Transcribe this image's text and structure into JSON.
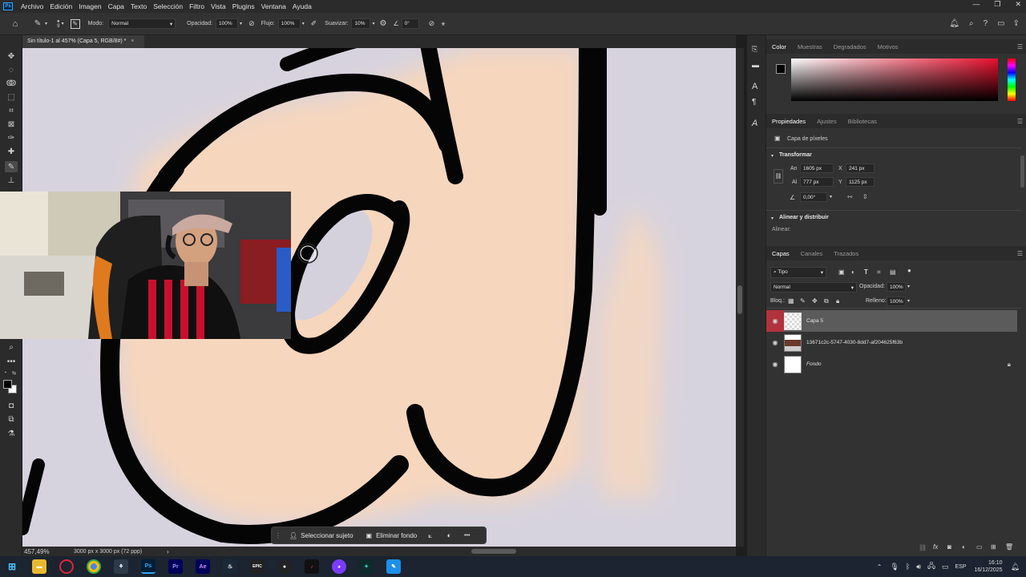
{
  "menubar": {
    "logo": "Ps",
    "items": [
      "Archivo",
      "Edición",
      "Imagen",
      "Capa",
      "Texto",
      "Selección",
      "Filtro",
      "Vista",
      "Plugins",
      "Ventana",
      "Ayuda"
    ]
  },
  "options": {
    "brush_size": "9",
    "mode_label": "Modo:",
    "mode_value": "Normal",
    "opacity_label": "Opacidad:",
    "opacity_value": "100%",
    "flow_label": "Flujo:",
    "flow_value": "100%",
    "smooth_label": "Suavizar:",
    "smooth_value": "10%",
    "angle_value": "0°"
  },
  "document": {
    "tab_title": "Sin título-1 al 457% (Capa 5, RGB/8#) *",
    "close": "×",
    "zoom": "457,49%",
    "size_info": "3000 px x 3000 px (72 ppp)",
    "status_arrow": "›"
  },
  "contextbar": {
    "select_subject": "Seleccionar sujeto",
    "remove_bg": "Eliminar fondo",
    "more": "•••"
  },
  "color_panel": {
    "tabs": [
      "Color",
      "Muestras",
      "Degradados",
      "Motivos"
    ],
    "fg_color": "#000000",
    "bg_color": "#ffffff",
    "hue_color": "#e8102e"
  },
  "properties": {
    "tabs": [
      "Propiedades",
      "Ajustes",
      "Bibliotecas"
    ],
    "layer_type": "Capa de píxeles",
    "transform_title": "Transformar",
    "an_label": "An",
    "an_value": "1605 px",
    "x_label": "X",
    "x_value": "241 px",
    "al_label": "Al",
    "al_value": "777 px",
    "y_label": "Y",
    "y_value": "1125 px",
    "angle_value": "0,00°",
    "align_title": "Alinear y distribuir",
    "align_label": "Alinear:"
  },
  "layers": {
    "tabs": [
      "Capas",
      "Canales",
      "Trazados"
    ],
    "filter_label": "Tipo",
    "blend_mode": "Normal",
    "opacity_label": "Opacidad:",
    "opacity_value": "100%",
    "lock_label": "Bloq.:",
    "fill_label": "Relleno:",
    "fill_value": "100%",
    "items": [
      {
        "name": "Capa 5"
      },
      {
        "name": "13671c2c-5747-4030-8dd7-af204625f63b"
      },
      {
        "name": "Fondo"
      }
    ]
  },
  "taskbar": {
    "lang": "ESP",
    "time": "16:10",
    "date": "16/12/2025",
    "apps": [
      "Pr",
      "Ae",
      "Ps"
    ]
  }
}
